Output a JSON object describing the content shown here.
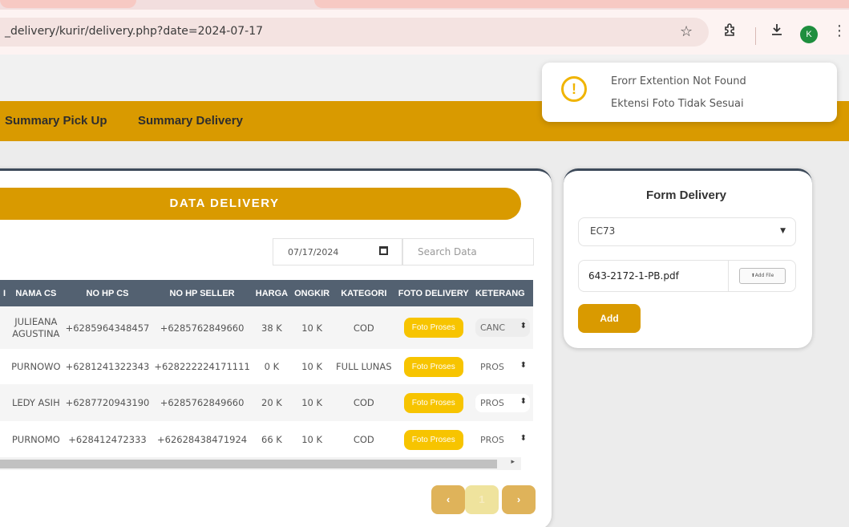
{
  "browser": {
    "url": "_delivery/kurir/delivery.php?date=2024-07-17",
    "profile_initial": "K"
  },
  "nav": {
    "items": [
      "Summary Pick Up",
      "Summary Delivery"
    ]
  },
  "toast": {
    "title": "Erorr Extention Not Found",
    "message": "Ektensi Foto Tidak Sesuai"
  },
  "data_card": {
    "title": "DATA DELIVERY",
    "date_value": "07/17/2024",
    "search_placeholder": "Search Data",
    "columns": [
      "NAMA CS",
      "NO HP CS",
      "NO HP SELLER",
      "HARGA",
      "ONGKIR",
      "KATEGORI",
      "FOTO DELIVERY",
      "KETERANG"
    ],
    "rows": [
      {
        "nama": "JULIEANA AGUSTINA",
        "hp_cs": "+6285964348457",
        "hp_seller": "+6285762849660",
        "harga": "38 K",
        "ongkir": "10 K",
        "kategori": "COD",
        "foto": "Foto Proses",
        "ket": "CANC"
      },
      {
        "nama": "PURNOWO",
        "hp_cs": "+6281241322343",
        "hp_seller": "+628222224171111",
        "harga": "0 K",
        "ongkir": "10 K",
        "kategori": "FULL LUNAS",
        "foto": "Foto Proses",
        "ket": "PROS"
      },
      {
        "nama": "LEDY ASIH",
        "hp_cs": "+6287720943190",
        "hp_seller": "+6285762849660",
        "harga": "20 K",
        "ongkir": "10 K",
        "kategori": "COD",
        "foto": "Foto Proses",
        "ket": "PROS"
      },
      {
        "nama": "PURNOMO",
        "hp_cs": "+628412472333",
        "hp_seller": "+62628438471924",
        "harga": "66 K",
        "ongkir": "10 K",
        "kategori": "COD",
        "foto": "Foto Proses",
        "ket": "PROS"
      }
    ],
    "pagination": {
      "prev": "‹",
      "current": "1",
      "next": "›"
    }
  },
  "form": {
    "title": "Form Delivery",
    "select_value": "EC73",
    "file_name": "643-2172-1-PB.pdf",
    "add_file_label": "Add File",
    "add_button": "Add"
  },
  "colors": {
    "accent": "#d99a00",
    "table_header": "#536171",
    "foto_button": "#f7c400"
  },
  "icons": [
    "warning-icon",
    "calendar-icon",
    "star-icon",
    "extensions-icon",
    "download-icon",
    "kebab-icon",
    "upload-icon"
  ]
}
